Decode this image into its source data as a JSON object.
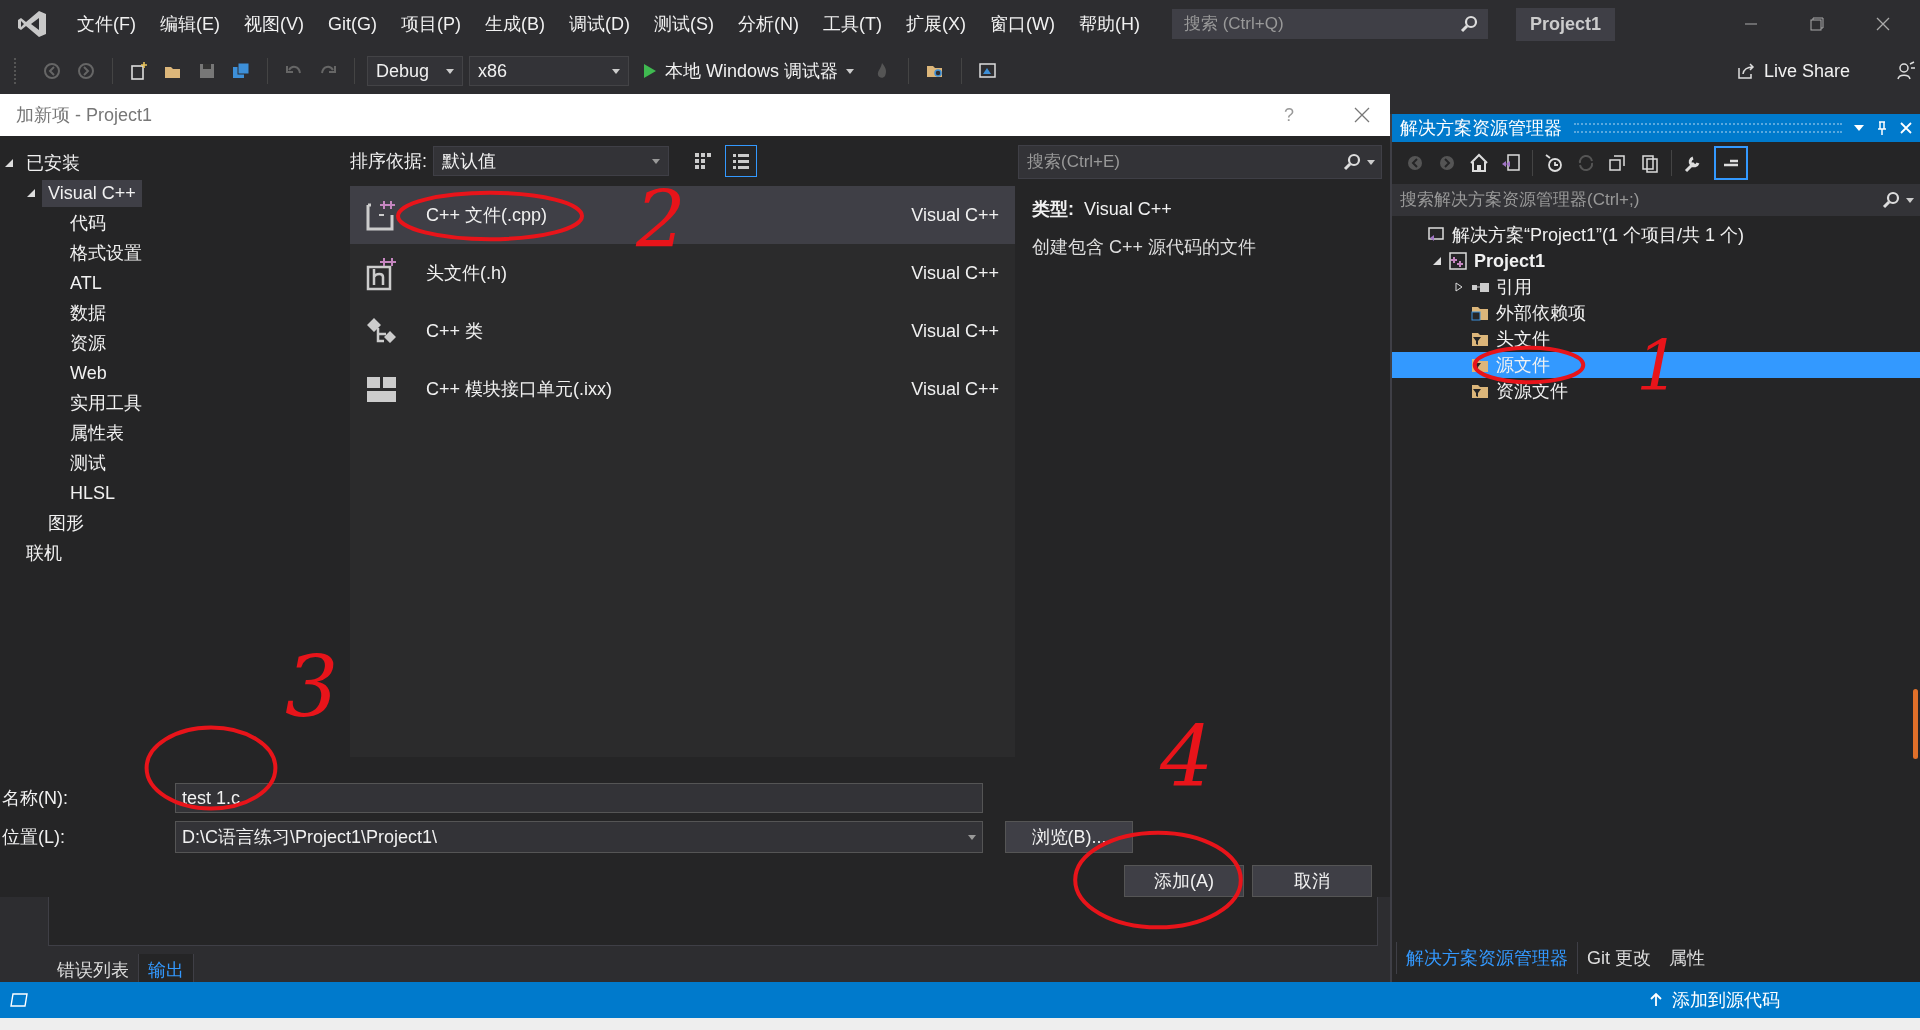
{
  "menu_bar": {
    "items": [
      "文件(F)",
      "编辑(E)",
      "视图(V)",
      "Git(G)",
      "项目(P)",
      "生成(B)",
      "调试(D)",
      "测试(S)",
      "分析(N)",
      "工具(T)",
      "扩展(X)",
      "窗口(W)",
      "帮助(H)"
    ],
    "search": {
      "placeholder": "搜索 (Ctrl+Q)"
    },
    "project_name": "Project1"
  },
  "toolbar": {
    "configuration": "Debug",
    "platform": "x86",
    "debugger": "本地 Windows 调试器",
    "live_share": "Live Share"
  },
  "dialog": {
    "title": "加新项 - Project1",
    "help": "?",
    "tree": [
      {
        "label": "已安装",
        "expanded": true,
        "selected": false,
        "children": [
          {
            "label": "Visual C++",
            "expanded": true,
            "selected": true,
            "children": [
              {
                "label": "代码",
                "selected": false
              },
              {
                "label": "格式设置",
                "selected": false
              },
              {
                "label": "ATL",
                "selected": false
              },
              {
                "label": "数据",
                "selected": false
              },
              {
                "label": "资源",
                "selected": false
              },
              {
                "label": "Web",
                "selected": false
              },
              {
                "label": "实用工具",
                "selected": false
              },
              {
                "label": "属性表",
                "selected": false
              },
              {
                "label": "测试",
                "selected": false
              },
              {
                "label": "HLSL",
                "selected": false
              }
            ]
          },
          {
            "label": "图形",
            "selected": false
          }
        ]
      },
      {
        "label": "联机",
        "selected": false
      }
    ],
    "sort": {
      "label": "排序依据:",
      "value": "默认值"
    },
    "views": [
      {
        "kind": "grid",
        "selected": false
      },
      {
        "kind": "list",
        "selected": true
      }
    ],
    "search": {
      "placeholder": "搜索(Ctrl+E)"
    },
    "templates": [
      {
        "kind": "cpp",
        "name": "C++ 文件(.cpp)",
        "category": "Visual C++",
        "selected": true,
        "annotation": "2"
      },
      {
        "kind": "header",
        "name": "头文件(.h)",
        "category": "Visual C++",
        "selected": false
      },
      {
        "kind": "class",
        "name": "C++ 类",
        "category": "Visual C++",
        "selected": false
      },
      {
        "kind": "module",
        "name": "C++ 模块接口单元(.ixx)",
        "category": "Visual C++",
        "selected": false
      }
    ],
    "details": {
      "type_label": "类型:",
      "type_value": "Visual C++",
      "description": "创建包含 C++ 源代码的文件"
    },
    "name_field": {
      "label": "名称(N):",
      "value": "test 1.c",
      "annotation": "3"
    },
    "location_field": {
      "label": "位置(L):",
      "value": "D:\\C语言练习\\Project1\\Project1\\"
    },
    "browse_button": "浏览(B)...",
    "buttons": [
      {
        "label": "添加(A)",
        "annotation": "4"
      },
      {
        "label": "取消"
      }
    ]
  },
  "output_panel": {
    "tabs": [
      {
        "label": "错误列表",
        "selected": false
      },
      {
        "label": "输出",
        "selected": true
      }
    ]
  },
  "solution_explorer": {
    "title": "解决方案资源管理器",
    "search": {
      "placeholder": "搜索解决方案资源管理器(Ctrl+;)"
    },
    "tree": [
      {
        "kind": "solution",
        "label": "解决方案“Project1”(1 个项目/共 1 个)",
        "selected": false,
        "children": [
          {
            "kind": "project",
            "label": "Project1",
            "expanded": true,
            "selected": false,
            "children": [
              {
                "kind": "references",
                "label": "引用",
                "expanded": false,
                "selected": false
              },
              {
                "kind": "external",
                "label": "外部依赖项",
                "selected": false
              },
              {
                "kind": "filter",
                "label": "头文件",
                "selected": false
              },
              {
                "kind": "filter",
                "label": "源文件",
                "selected": true,
                "annotation": "1"
              },
              {
                "kind": "filter",
                "label": "资源文件",
                "selected": false
              }
            ]
          }
        ]
      }
    ],
    "tabs": [
      {
        "label": "解决方案资源管理器",
        "selected": true
      },
      {
        "label": "Git 更改",
        "selected": false
      },
      {
        "label": "属性",
        "selected": false
      }
    ]
  },
  "status_bar": {
    "text": "添加到源代码"
  }
}
